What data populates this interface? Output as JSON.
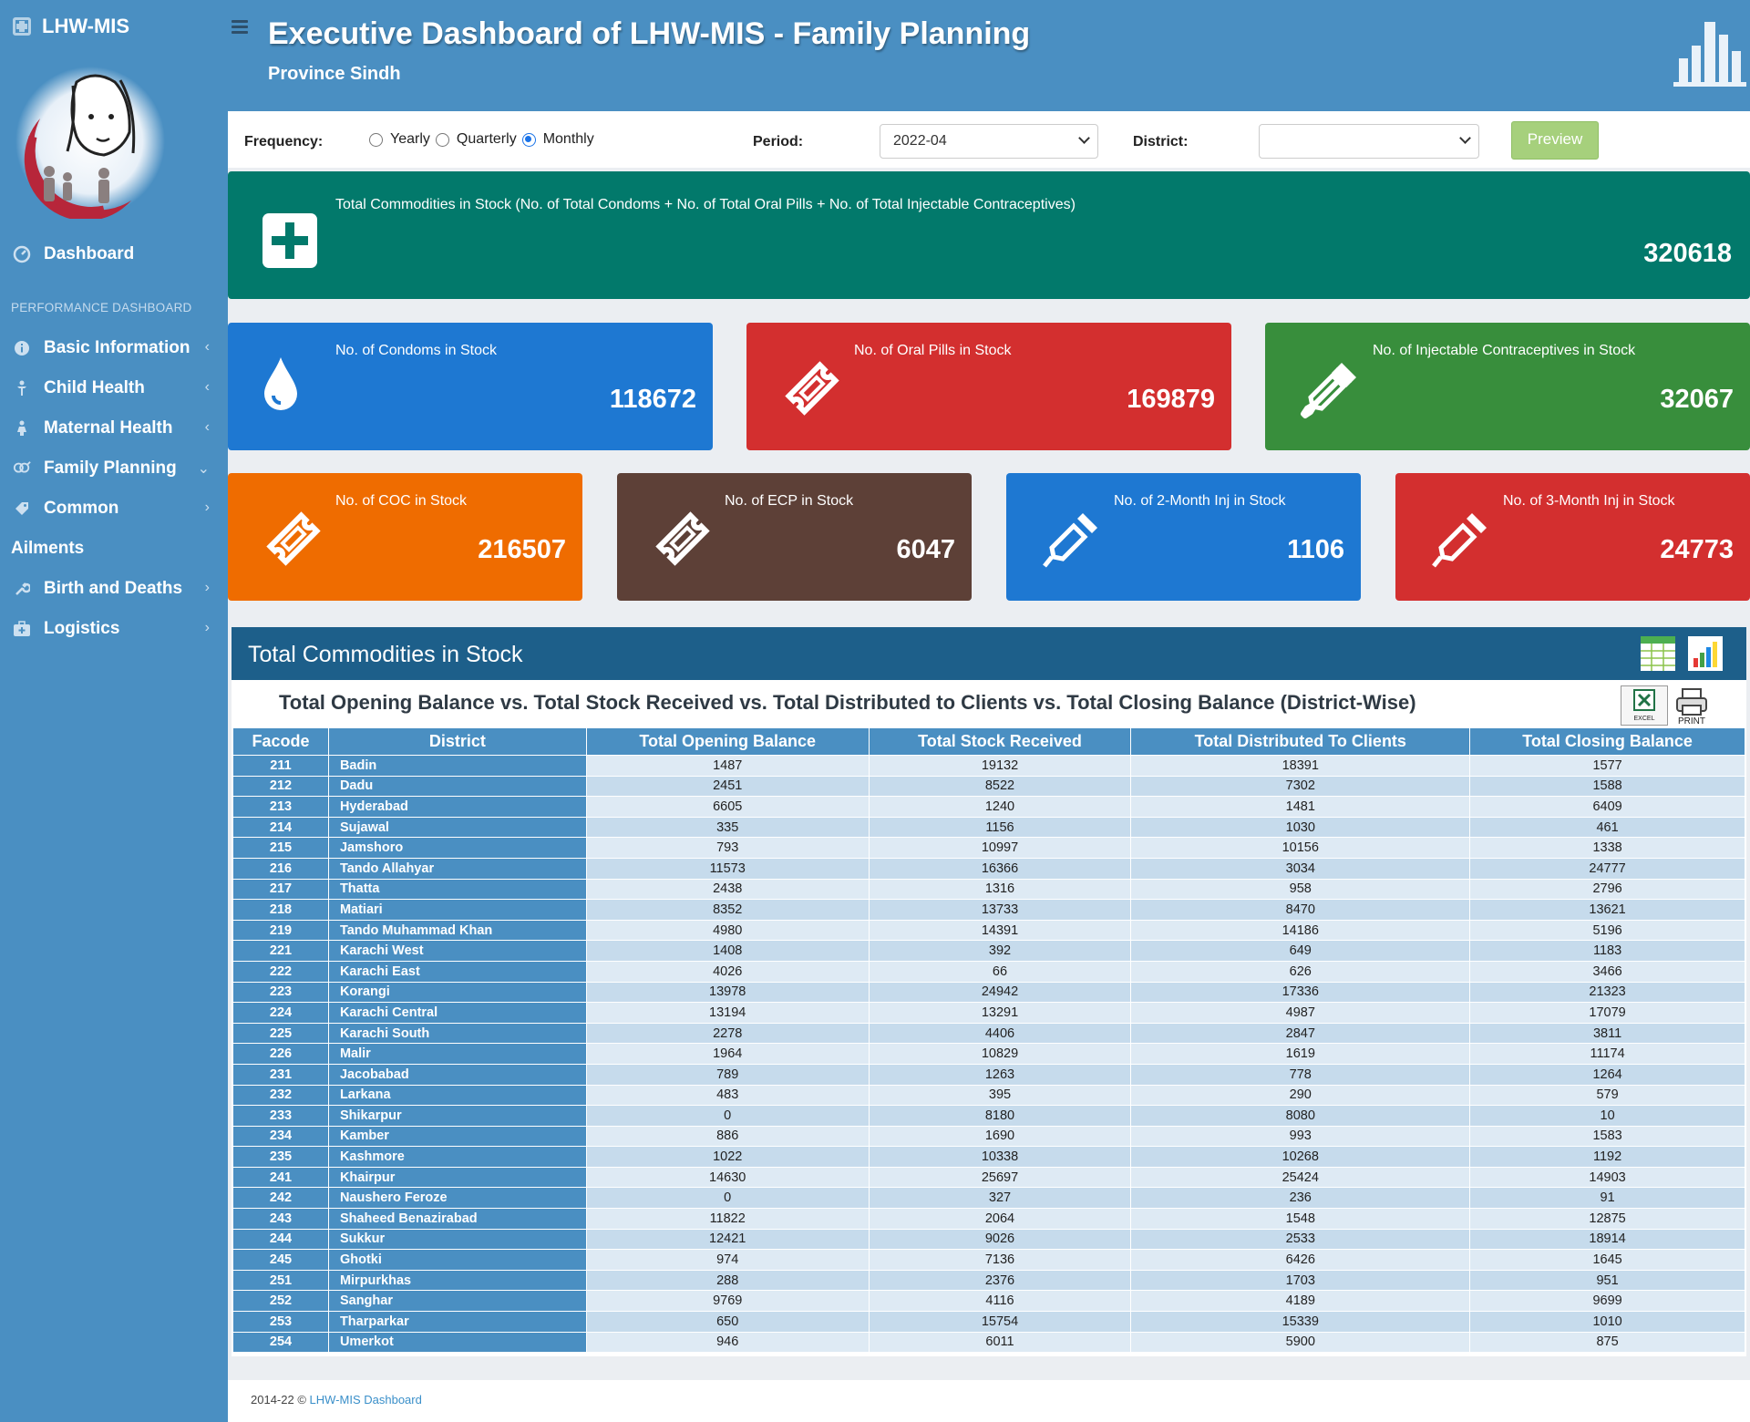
{
  "sidebar": {
    "brand": "LHW-MIS",
    "dashboard": "Dashboard",
    "section": "PERFORMANCE DASHBOARD",
    "items": [
      {
        "label": "Basic Information",
        "icon": "info-icon",
        "chev": "‹"
      },
      {
        "label": "Child Health",
        "icon": "child-icon",
        "chev": "‹"
      },
      {
        "label": "Maternal Health",
        "icon": "mother-icon",
        "chev": "‹"
      },
      {
        "label": "Family Planning",
        "icon": "gender-icon",
        "chev": "⌄"
      },
      {
        "label": "Common",
        "icon": "tag-icon",
        "chev": "›"
      },
      {
        "label": "Ailments",
        "icon": "",
        "chev": ""
      },
      {
        "label": "Birth and Deaths",
        "icon": "wrench-icon",
        "chev": "›"
      },
      {
        "label": "Logistics",
        "icon": "medkit-icon",
        "chev": "›"
      }
    ]
  },
  "header": {
    "title": "Executive Dashboard of LHW-MIS - Family Planning",
    "subtitle": "Province Sindh"
  },
  "filters": {
    "frequency_label": "Frequency:",
    "options": [
      "Yearly",
      "Quarterly",
      "Monthly"
    ],
    "selected": "Monthly",
    "period_label": "Period:",
    "period_value": "2022-04",
    "district_label": "District:",
    "district_value": "",
    "preview": "Preview"
  },
  "cards": {
    "total": {
      "label": "Total Commodities in Stock (No. of Total Condoms + No. of Total Oral Pills + No. of Total Injectable Contraceptives)",
      "value": "320618",
      "color": "#02796b"
    },
    "condoms": {
      "label": "No. of Condoms in Stock",
      "value": "118672",
      "color": "#1e78d2"
    },
    "oral_pills": {
      "label": "No. of Oral Pills in Stock",
      "value": "169879",
      "color": "#d32f2f"
    },
    "injectable": {
      "label": "No. of Injectable Contraceptives in Stock",
      "value": "32067",
      "color": "#388e3c"
    },
    "coc": {
      "label": "No. of COC in Stock",
      "value": "216507",
      "color": "#ef6c00"
    },
    "ecp": {
      "label": "No. of ECP in Stock",
      "value": "6047",
      "color": "#5d4037"
    },
    "inj2": {
      "label": "No. of 2-Month Inj in Stock",
      "value": "1106",
      "color": "#1e78d2"
    },
    "inj3": {
      "label": "No. of 3-Month Inj in Stock",
      "value": "24773",
      "color": "#d32f2f"
    }
  },
  "panel": {
    "title": "Total Commodities in Stock",
    "table_title": "Total Opening Balance vs. Total Stock Received vs. Total Distributed to Clients vs. Total Closing Balance (District-Wise)",
    "excel": "EXCEL",
    "print": "PRINT",
    "columns": [
      "Facode",
      "District",
      "Total Opening Balance",
      "Total Stock Received",
      "Total Distributed To Clients",
      "Total Closing Balance"
    ],
    "rows": [
      [
        "211",
        "Badin",
        "1487",
        "19132",
        "18391",
        "1577"
      ],
      [
        "212",
        "Dadu",
        "2451",
        "8522",
        "7302",
        "1588"
      ],
      [
        "213",
        "Hyderabad",
        "6605",
        "1240",
        "1481",
        "6409"
      ],
      [
        "214",
        "Sujawal",
        "335",
        "1156",
        "1030",
        "461"
      ],
      [
        "215",
        "Jamshoro",
        "793",
        "10997",
        "10156",
        "1338"
      ],
      [
        "216",
        "Tando Allahyar",
        "11573",
        "16366",
        "3034",
        "24777"
      ],
      [
        "217",
        "Thatta",
        "2438",
        "1316",
        "958",
        "2796"
      ],
      [
        "218",
        "Matiari",
        "8352",
        "13733",
        "8470",
        "13621"
      ],
      [
        "219",
        "Tando Muhammad Khan",
        "4980",
        "14391",
        "14186",
        "5196"
      ],
      [
        "221",
        "Karachi West",
        "1408",
        "392",
        "649",
        "1183"
      ],
      [
        "222",
        "Karachi East",
        "4026",
        "66",
        "626",
        "3466"
      ],
      [
        "223",
        "Korangi",
        "13978",
        "24942",
        "17336",
        "21323"
      ],
      [
        "224",
        "Karachi Central",
        "13194",
        "13291",
        "4987",
        "17079"
      ],
      [
        "225",
        "Karachi South",
        "2278",
        "4406",
        "2847",
        "3811"
      ],
      [
        "226",
        "Malir",
        "1964",
        "10829",
        "1619",
        "11174"
      ],
      [
        "231",
        "Jacobabad",
        "789",
        "1263",
        "778",
        "1264"
      ],
      [
        "232",
        "Larkana",
        "483",
        "395",
        "290",
        "579"
      ],
      [
        "233",
        "Shikarpur",
        "0",
        "8180",
        "8080",
        "10"
      ],
      [
        "234",
        "Kamber",
        "886",
        "1690",
        "993",
        "1583"
      ],
      [
        "235",
        "Kashmore",
        "1022",
        "10338",
        "10268",
        "1192"
      ],
      [
        "241",
        "Khairpur",
        "14630",
        "25697",
        "25424",
        "14903"
      ],
      [
        "242",
        "Naushero Feroze",
        "0",
        "327",
        "236",
        "91"
      ],
      [
        "243",
        "Shaheed Benazirabad",
        "11822",
        "2064",
        "1548",
        "12875"
      ],
      [
        "244",
        "Sukkur",
        "12421",
        "9026",
        "2533",
        "18914"
      ],
      [
        "245",
        "Ghotki",
        "974",
        "7136",
        "6426",
        "1645"
      ],
      [
        "251",
        "Mirpurkhas",
        "288",
        "2376",
        "1703",
        "951"
      ],
      [
        "252",
        "Sanghar",
        "9769",
        "4116",
        "4189",
        "9699"
      ],
      [
        "253",
        "Tharparkar",
        "650",
        "15754",
        "15339",
        "1010"
      ],
      [
        "254",
        "Umerkot",
        "946",
        "6011",
        "5900",
        "875"
      ]
    ]
  },
  "footer": {
    "copy": "2014-22 ©",
    "link": "LHW-MIS Dashboard"
  }
}
